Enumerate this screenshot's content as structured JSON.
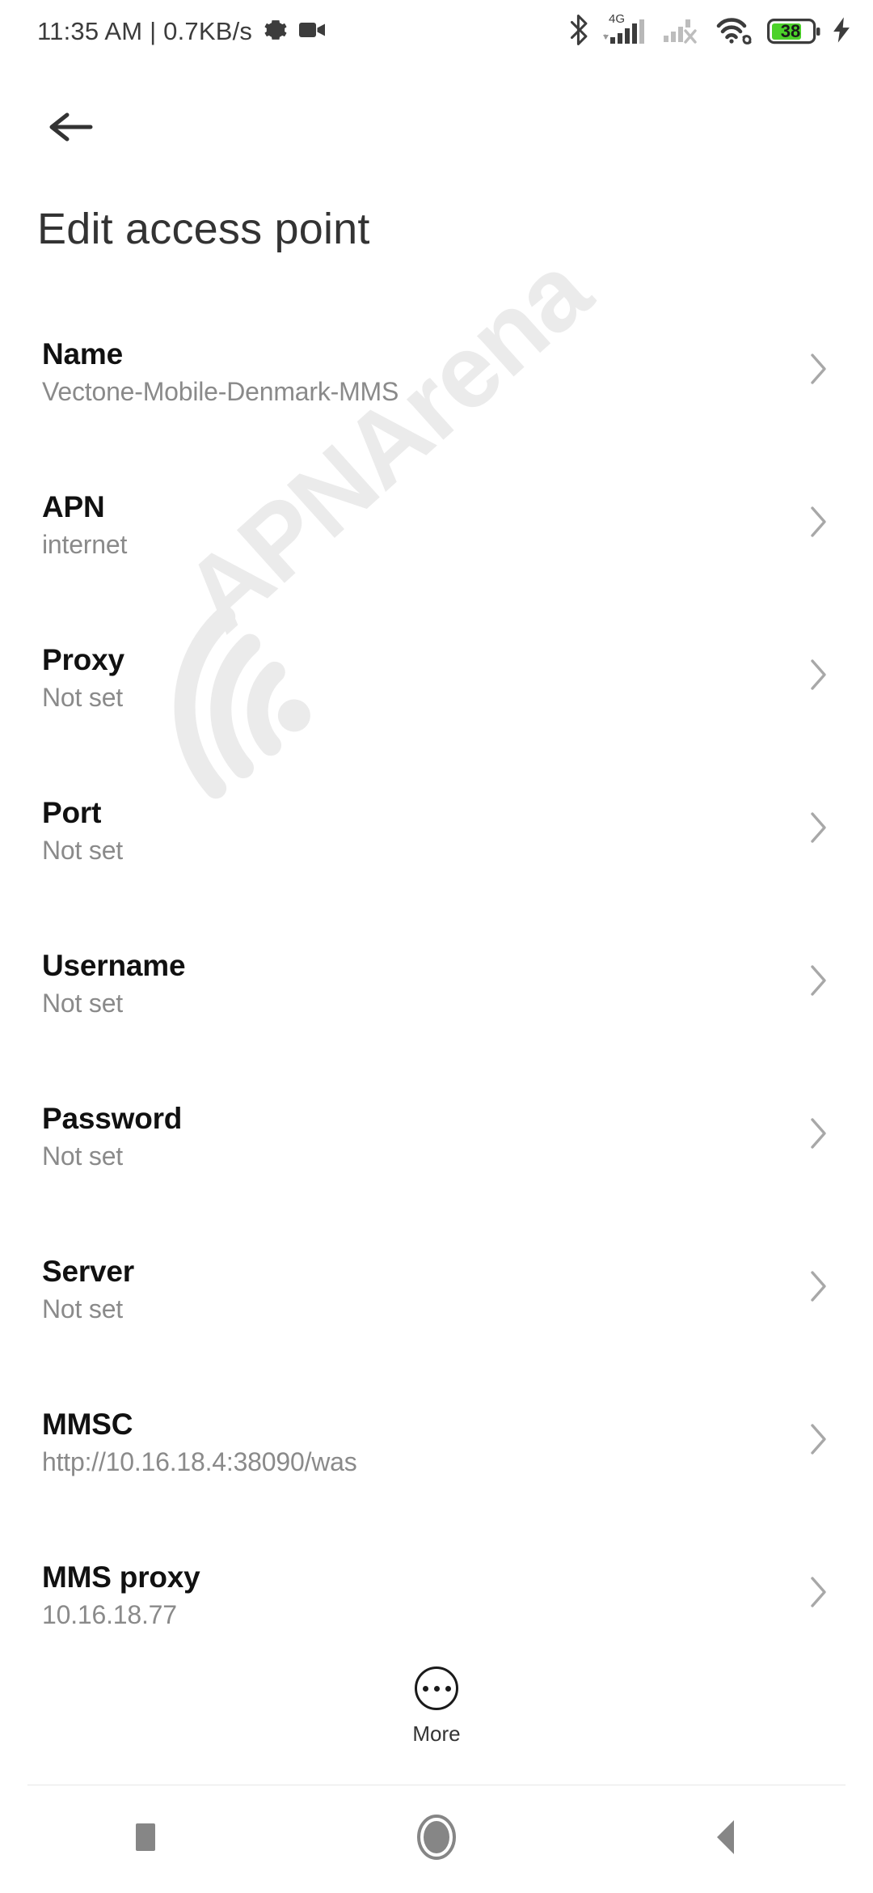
{
  "status_bar": {
    "clock": "11:35 AM | 0.7KB/s",
    "icons_left": [
      "gear-icon",
      "video-camera-icon"
    ],
    "icons_right": [
      "bluetooth-icon",
      "signal-4g-icon",
      "signal-sim2-off-icon",
      "wifi-icon",
      "battery-icon",
      "charging-bolt-icon"
    ],
    "network_label": "4G",
    "battery_percent": "38",
    "battery_color": "#4cd22a"
  },
  "header": {
    "back_icon": "arrow-left-icon",
    "title": "Edit access point"
  },
  "watermark": {
    "text": "APNArena",
    "icon": "wifi-arc-icon",
    "color": "#ebebeb"
  },
  "list": {
    "rows": [
      {
        "title": "Name",
        "value": "Vectone-Mobile-Denmark-MMS"
      },
      {
        "title": "APN",
        "value": "internet"
      },
      {
        "title": "Proxy",
        "value": "Not set"
      },
      {
        "title": "Port",
        "value": "Not set"
      },
      {
        "title": "Username",
        "value": "Not set"
      },
      {
        "title": "Password",
        "value": "Not set"
      },
      {
        "title": "Server",
        "value": "Not set"
      },
      {
        "title": "MMSC",
        "value": "http://10.16.18.4:38090/was"
      },
      {
        "title": "MMS proxy",
        "value": "10.16.18.77"
      }
    ],
    "chevron_icon": "chevron-right-icon"
  },
  "more_button": {
    "label": "More",
    "icon": "overflow-dots-circle-icon"
  },
  "nav_bar": {
    "recents_icon": "square-icon",
    "home_icon": "circle-icon",
    "back_icon": "triangle-left-icon"
  }
}
